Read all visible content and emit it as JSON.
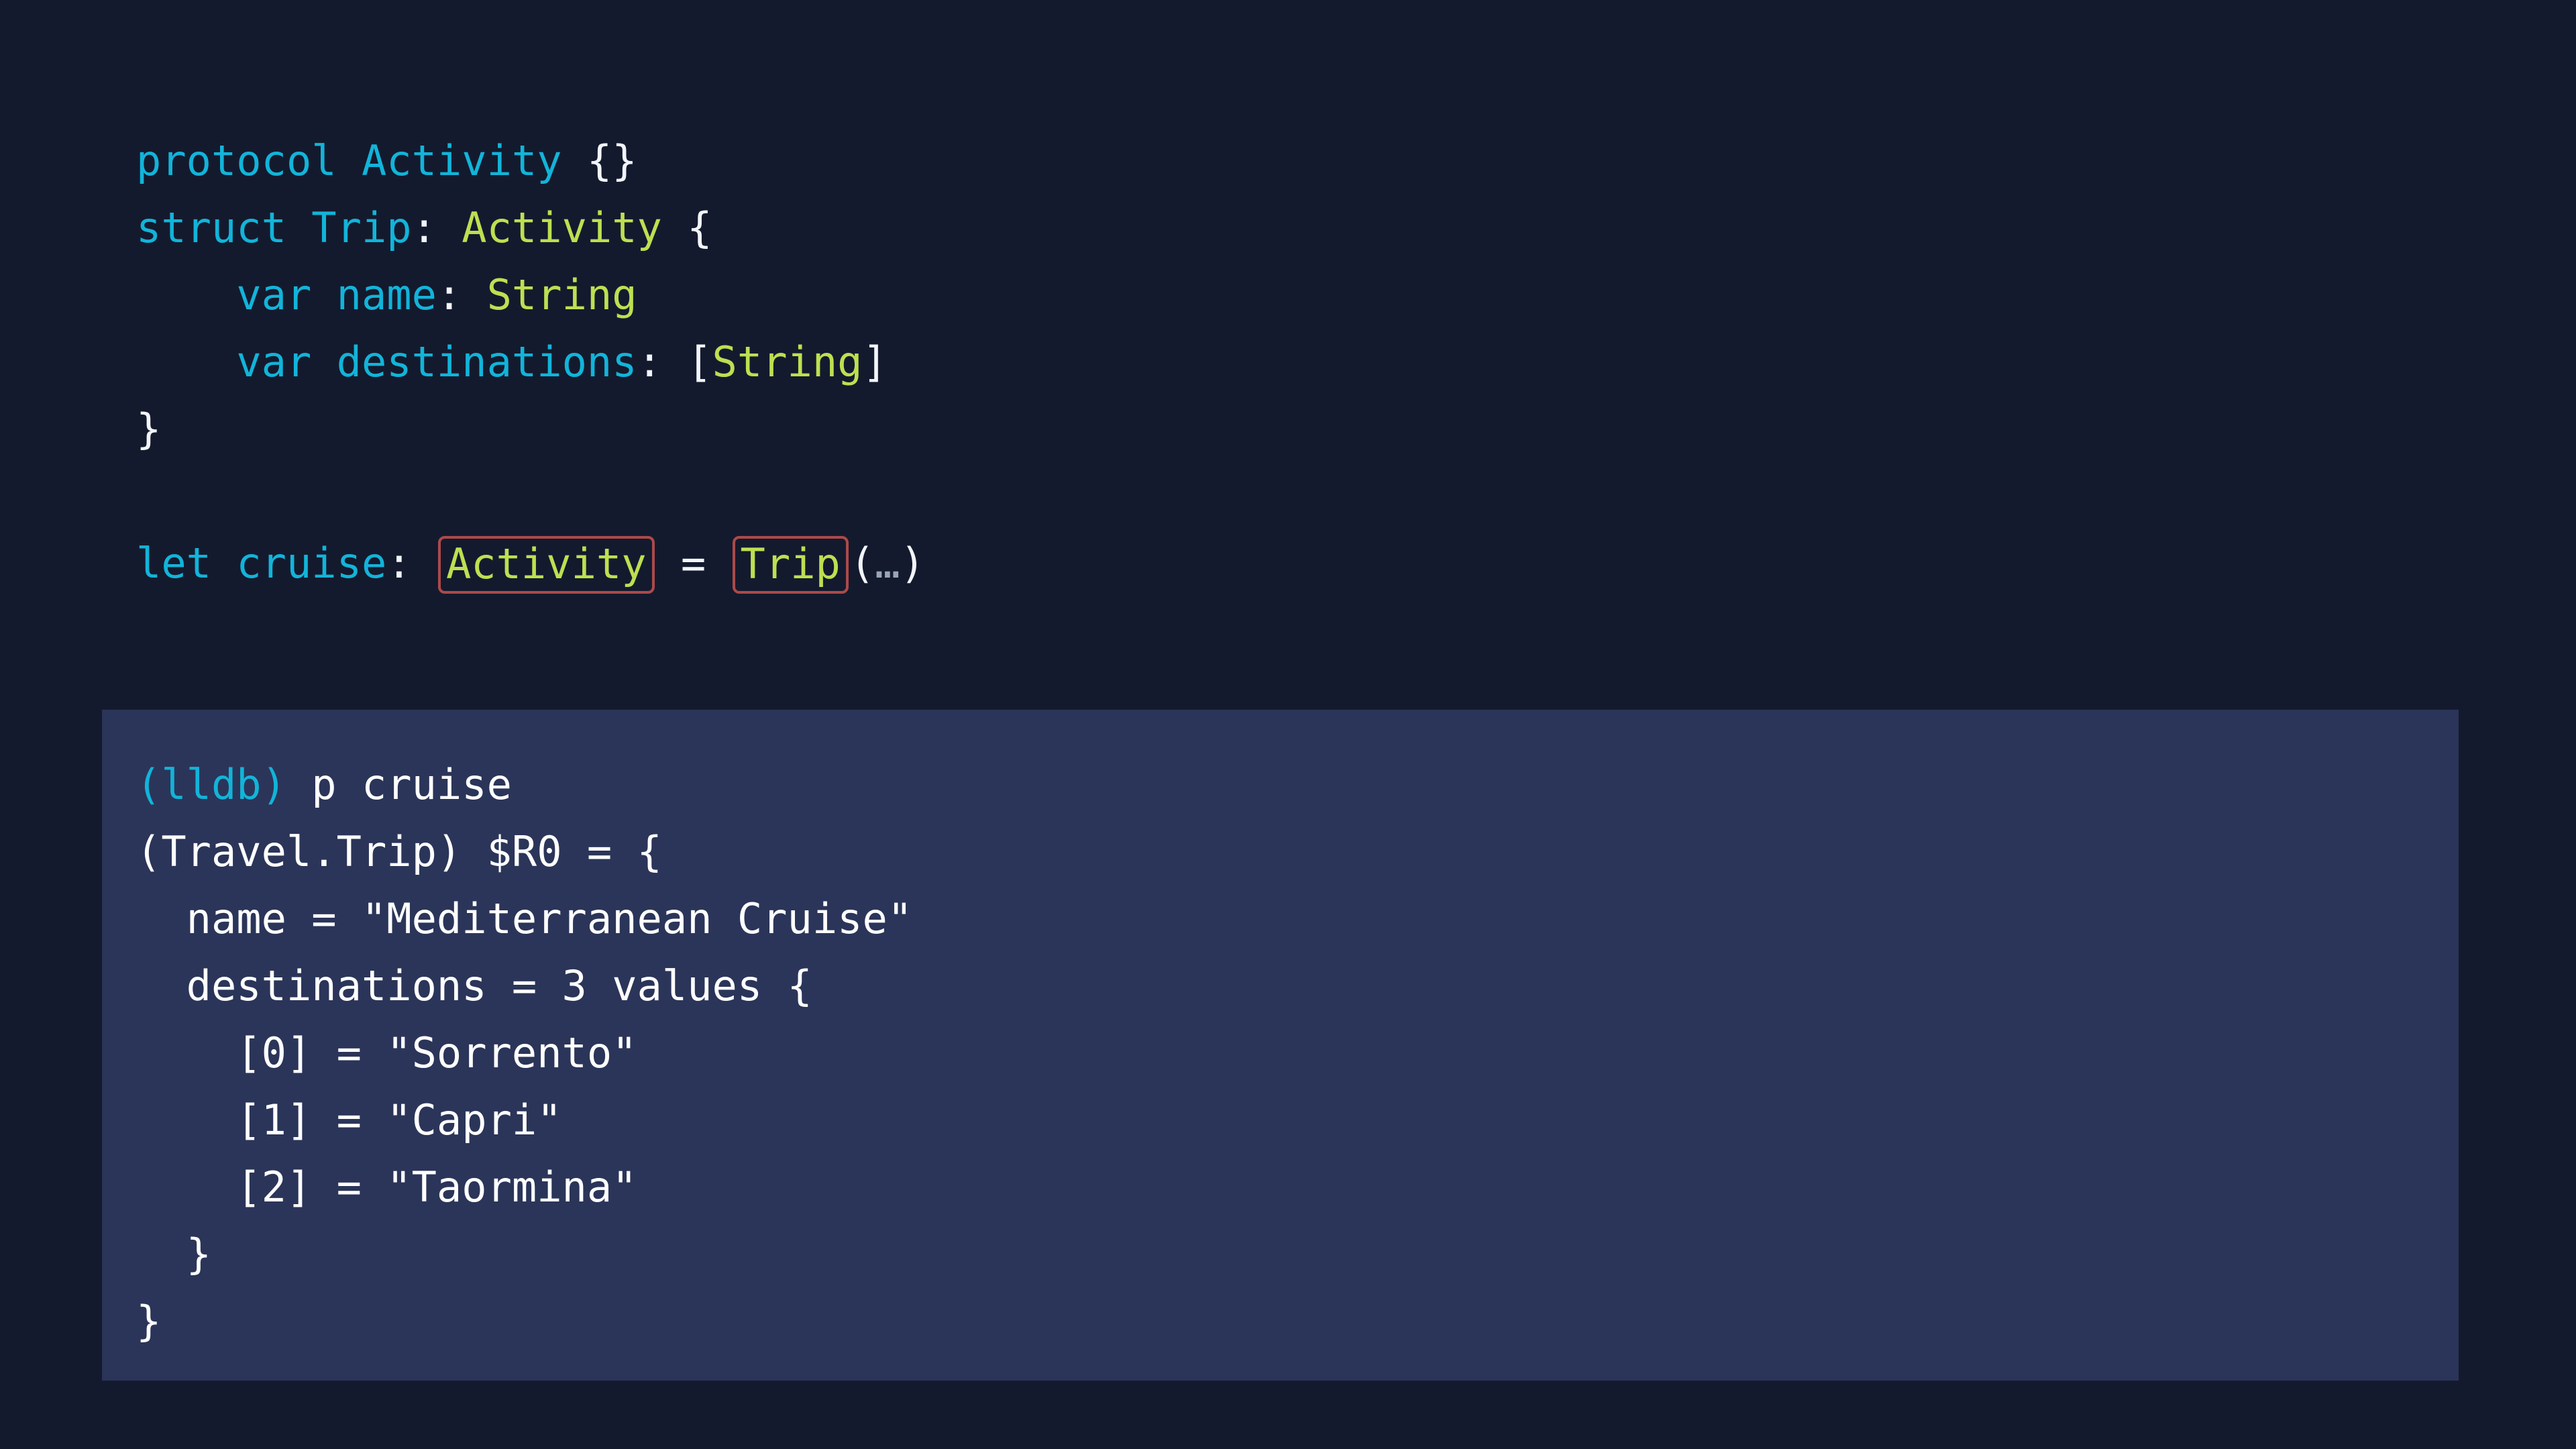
{
  "theme": {
    "page_background": "#141a2e",
    "console_background": "#2b3559",
    "keyword_color": "#12b4d9",
    "type_color": "#bce051",
    "punctuation_color": "#f2f5fa",
    "highlight_border_color": "#ac4a4a",
    "console_text_color": "#ffffff",
    "prompt_color": "#12b4d9"
  },
  "code": {
    "language": "swift",
    "lines": [
      {
        "id": "protocol-activity",
        "tokens": [
          {
            "text": "protocol",
            "kind": "kw"
          },
          {
            "text": " ",
            "kind": "punc"
          },
          {
            "text": "Activity",
            "kind": "decl"
          },
          {
            "text": " ",
            "kind": "punc"
          },
          {
            "text": "{}",
            "kind": "punc"
          }
        ]
      },
      {
        "id": "struct-trip",
        "tokens": [
          {
            "text": "struct",
            "kind": "kw"
          },
          {
            "text": " ",
            "kind": "punc"
          },
          {
            "text": "Trip",
            "kind": "decl"
          },
          {
            "text": ": ",
            "kind": "punc"
          },
          {
            "text": "Activity",
            "kind": "type"
          },
          {
            "text": " ",
            "kind": "punc"
          },
          {
            "text": "{",
            "kind": "punc"
          }
        ]
      },
      {
        "id": "var-name",
        "tokens": [
          {
            "text": "    ",
            "kind": "punc"
          },
          {
            "text": "var",
            "kind": "kw"
          },
          {
            "text": " ",
            "kind": "punc"
          },
          {
            "text": "name",
            "kind": "decl"
          },
          {
            "text": ": ",
            "kind": "punc"
          },
          {
            "text": "String",
            "kind": "type"
          }
        ]
      },
      {
        "id": "var-destinations",
        "tokens": [
          {
            "text": "    ",
            "kind": "punc"
          },
          {
            "text": "var",
            "kind": "kw"
          },
          {
            "text": " ",
            "kind": "punc"
          },
          {
            "text": "destinations",
            "kind": "decl"
          },
          {
            "text": ": ",
            "kind": "punc"
          },
          {
            "text": "[",
            "kind": "punc"
          },
          {
            "text": "String",
            "kind": "type"
          },
          {
            "text": "]",
            "kind": "punc"
          }
        ]
      },
      {
        "id": "struct-close",
        "tokens": [
          {
            "text": "}",
            "kind": "punc"
          }
        ]
      },
      {
        "id": "blank-1",
        "tokens": []
      },
      {
        "id": "let-cruise",
        "tokens": [
          {
            "text": "let",
            "kind": "kw"
          },
          {
            "text": " ",
            "kind": "punc"
          },
          {
            "text": "cruise",
            "kind": "decl"
          },
          {
            "text": ": ",
            "kind": "punc"
          },
          {
            "text": "Activity",
            "kind": "type",
            "highlighted": true
          },
          {
            "text": " = ",
            "kind": "punc"
          },
          {
            "text": "Trip",
            "kind": "type",
            "highlighted": true
          },
          {
            "text": "(",
            "kind": "punc"
          },
          {
            "text": "…",
            "kind": "dots"
          },
          {
            "text": ")",
            "kind": "punc"
          }
        ]
      }
    ]
  },
  "console": {
    "name": "lldb-debugger-console",
    "prompt_label": "(lldb)",
    "command": "p cruise",
    "output_lines": [
      "(Travel.Trip) $R0 = {",
      "  name = \"Mediterranean Cruise\"",
      "  destinations = 3 values {",
      "    [0] = \"Sorrento\"",
      "    [1] = \"Capri\"",
      "    [2] = \"Taormina\"",
      "  }",
      "}"
    ],
    "result_variable": "$R0",
    "result_type": "Travel.Trip",
    "fields": {
      "name": "Mediterranean Cruise",
      "destinations_count": "3 values",
      "destinations": [
        "Sorrento",
        "Capri",
        "Taormina"
      ]
    }
  }
}
